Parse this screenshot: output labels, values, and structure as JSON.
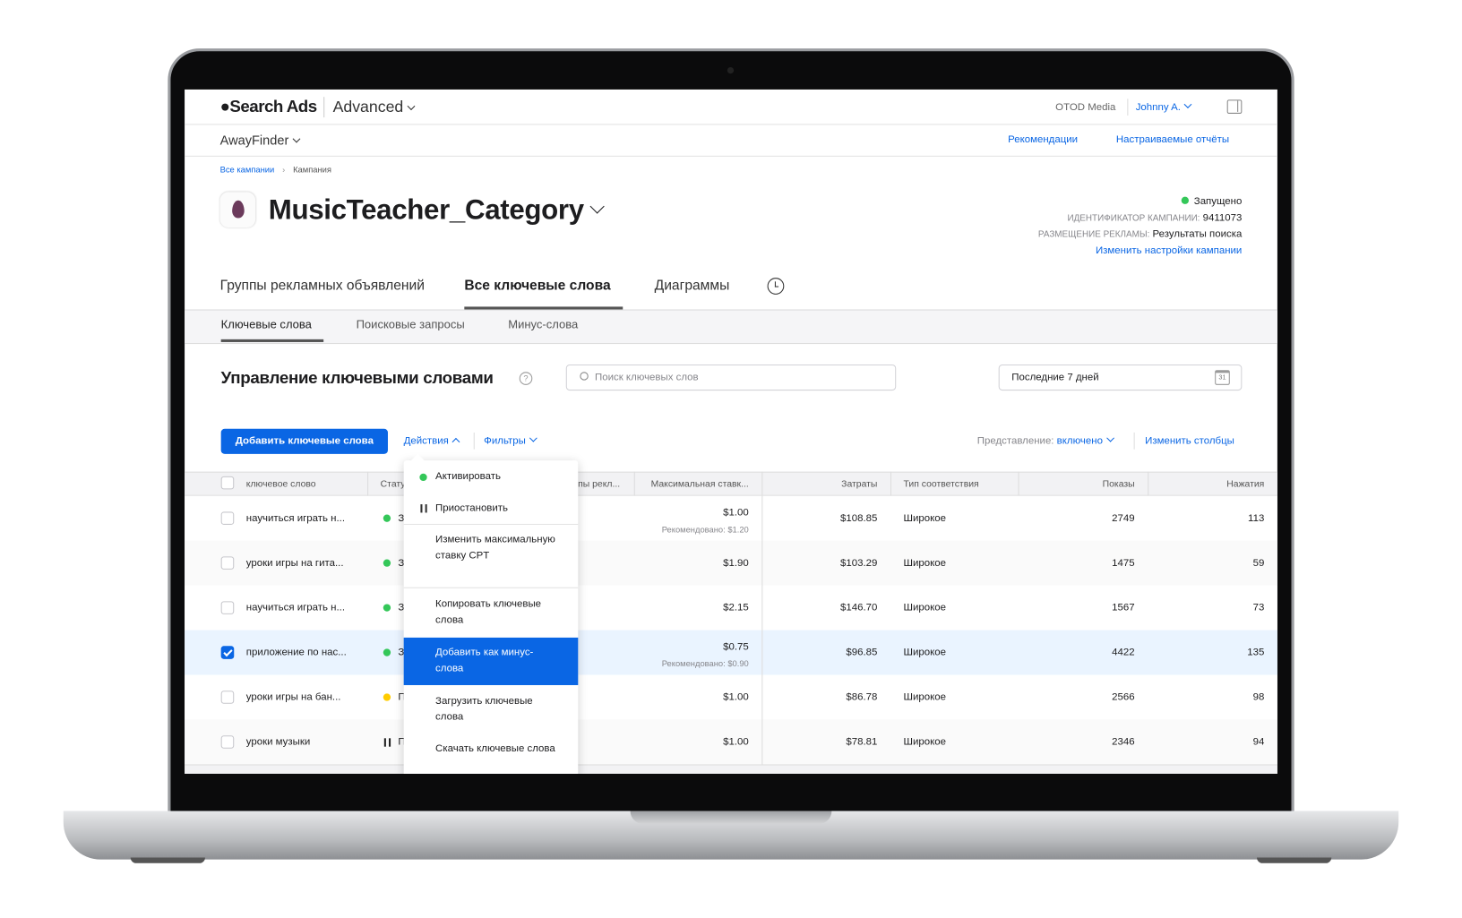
{
  "header": {
    "brand": "Search Ads",
    "edition": "Advanced",
    "org": "OTOD Media",
    "user": "Johnny A."
  },
  "subheader": {
    "app": "AwayFinder",
    "links": [
      "Рекомендации",
      "Настраиваемые отчёты"
    ]
  },
  "breadcrumb": [
    "Все кампании",
    "Кампания"
  ],
  "campaign": {
    "title": "MusicTeacher_Category",
    "status": "Запущено",
    "status_color": "#34c759",
    "id_label": "ИДЕНТИФИКАТОР КАМПАНИИ:",
    "id": "9411073",
    "placement_label": "РАЗМЕЩЕНИЕ РЕКЛАМЫ:",
    "placement": "Результаты поиска",
    "edit_link": "Изменить настройки кампании"
  },
  "tabs": [
    "Группы рекламных объявлений",
    "Все ключевые слова",
    "Диаграммы"
  ],
  "subtabs": [
    "Ключевые слова",
    "Поисковые запросы",
    "Минус-слова"
  ],
  "section": {
    "title": "Управление ключевыми словами",
    "search_placeholder": "Поиск ключевых слов",
    "date_range": "Последние 7 дней",
    "calendar_day": "31"
  },
  "toolbar": {
    "add": "Добавить ключевые слова",
    "actions": "Действия",
    "filters": "Фильтры",
    "view_label": "Представление:",
    "view_value": "включено",
    "columns": "Изменить столбцы"
  },
  "table": {
    "headers": [
      "ключевое слово",
      "Стату",
      "…пы рекл...",
      "Максимальная ставк...",
      "Затраты",
      "Тип соответствия",
      "Показы",
      "Нажатия"
    ],
    "rows": [
      {
        "keyword": "научиться играть н...",
        "status": "active",
        "status_char": "З",
        "checked": false,
        "bid": "$1.00",
        "rec": "Рекомендовано: $1.20",
        "cost": "$108.85",
        "match": "Широкое",
        "imp": "2749",
        "taps": "113"
      },
      {
        "keyword": "уроки игры на гита...",
        "status": "active",
        "status_char": "З",
        "checked": false,
        "bid": "$1.90",
        "rec": "",
        "cost": "$103.29",
        "match": "Широкое",
        "imp": "1475",
        "taps": "59"
      },
      {
        "keyword": "научиться играть н...",
        "status": "active",
        "status_char": "З",
        "checked": false,
        "bid": "$2.15",
        "rec": "",
        "cost": "$146.70",
        "match": "Широкое",
        "imp": "1567",
        "taps": "73"
      },
      {
        "keyword": "приложение по нас...",
        "status": "active",
        "status_char": "З",
        "checked": true,
        "bid": "$0.75",
        "rec": "Рекомендовано: $0.90",
        "cost": "$96.85",
        "match": "Широкое",
        "imp": "4422",
        "taps": "135"
      },
      {
        "keyword": "уроки игры на бан...",
        "status": "warning",
        "status_char": "П",
        "checked": false,
        "bid": "$1.00",
        "rec": "",
        "cost": "$86.78",
        "match": "Широкое",
        "imp": "2566",
        "taps": "98"
      },
      {
        "keyword": "уроки музыки",
        "status": "paused",
        "status_char": "П",
        "checked": false,
        "bid": "$1.00",
        "rec": "",
        "cost": "$78.81",
        "match": "Широкое",
        "imp": "2346",
        "taps": "94"
      }
    ]
  },
  "menu": {
    "items": [
      "Активировать",
      "Приостановить",
      "Изменить максимальную ставку CPT",
      "Копировать ключевые слова",
      "Добавить как минус-слова",
      "Загрузить ключевые слова",
      "Скачать ключевые слова"
    ],
    "highlighted": "Добавить как минус-слова"
  },
  "colors": {
    "accent": "#0a66e4",
    "active": "#34c759",
    "warning": "#ffcc00",
    "selected_row": "#eaf4ff"
  }
}
